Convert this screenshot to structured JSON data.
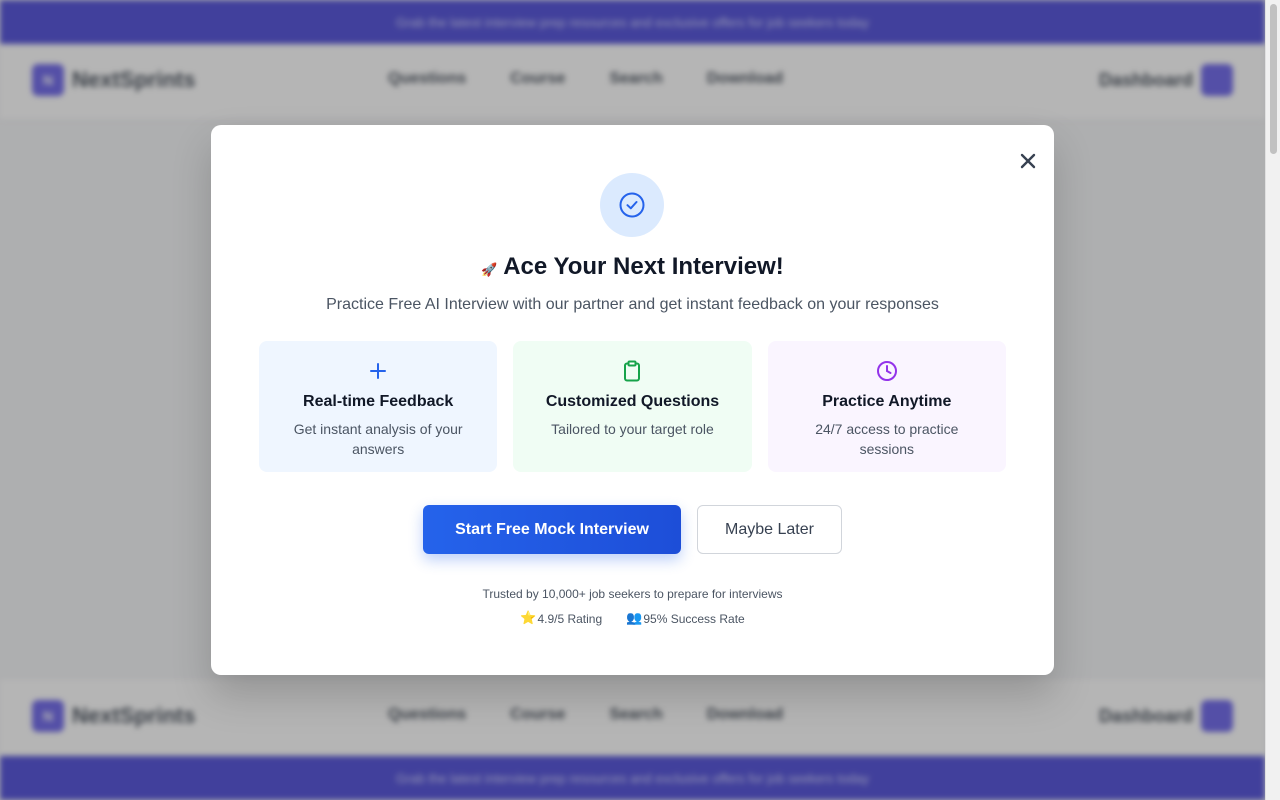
{
  "background": {
    "banner_text": "Grab the latest interview prep resources and exclusive offers for job seekers today",
    "bottom_banner_text": "Grab the latest interview prep resources and exclusive offers for job seekers today",
    "logo_text": "NextSprints",
    "nav_items": [
      "Questions",
      "Course",
      "Search",
      "Download"
    ],
    "right_text": "Dashboard",
    "footer_logo_text": "NextSprints",
    "footer_nav_items": [
      "Questions",
      "Course",
      "Search",
      "Download"
    ],
    "footer_right_text": "Dashboard"
  },
  "modal": {
    "close_icon": "close-icon",
    "hero_icon": "check-circle-icon",
    "title_emoji": "🚀",
    "title": "Ace Your Next Interview!",
    "subtitle": "Practice Free AI Interview with our partner and get instant feedback on your responses",
    "features": [
      {
        "icon": "plus-icon",
        "title": "Real-time Feedback",
        "description": "Get instant analysis of your answers",
        "color": "#2563eb",
        "bg": "#eff6ff"
      },
      {
        "icon": "clipboard-icon",
        "title": "Customized Questions",
        "description": "Tailored to your target role",
        "color": "#16a34a",
        "bg": "#f0fdf4"
      },
      {
        "icon": "clock-icon",
        "title": "Practice Anytime",
        "description": "24/7 access to practice sessions",
        "color": "#9333ea",
        "bg": "#faf5ff"
      }
    ],
    "primary_button": "Start Free Mock Interview",
    "secondary_button": "Maybe Later",
    "trust_text": "Trusted by 10,000+ job seekers to prepare for interviews",
    "stats": [
      {
        "emoji": "⭐",
        "label": "4.9/5 Rating"
      },
      {
        "emoji": "👥",
        "label": "95% Success Rate"
      }
    ]
  },
  "colors": {
    "accent": "#2563eb",
    "banner": "#2d2bd1",
    "overlay": "rgba(90,90,90,0.45)"
  }
}
